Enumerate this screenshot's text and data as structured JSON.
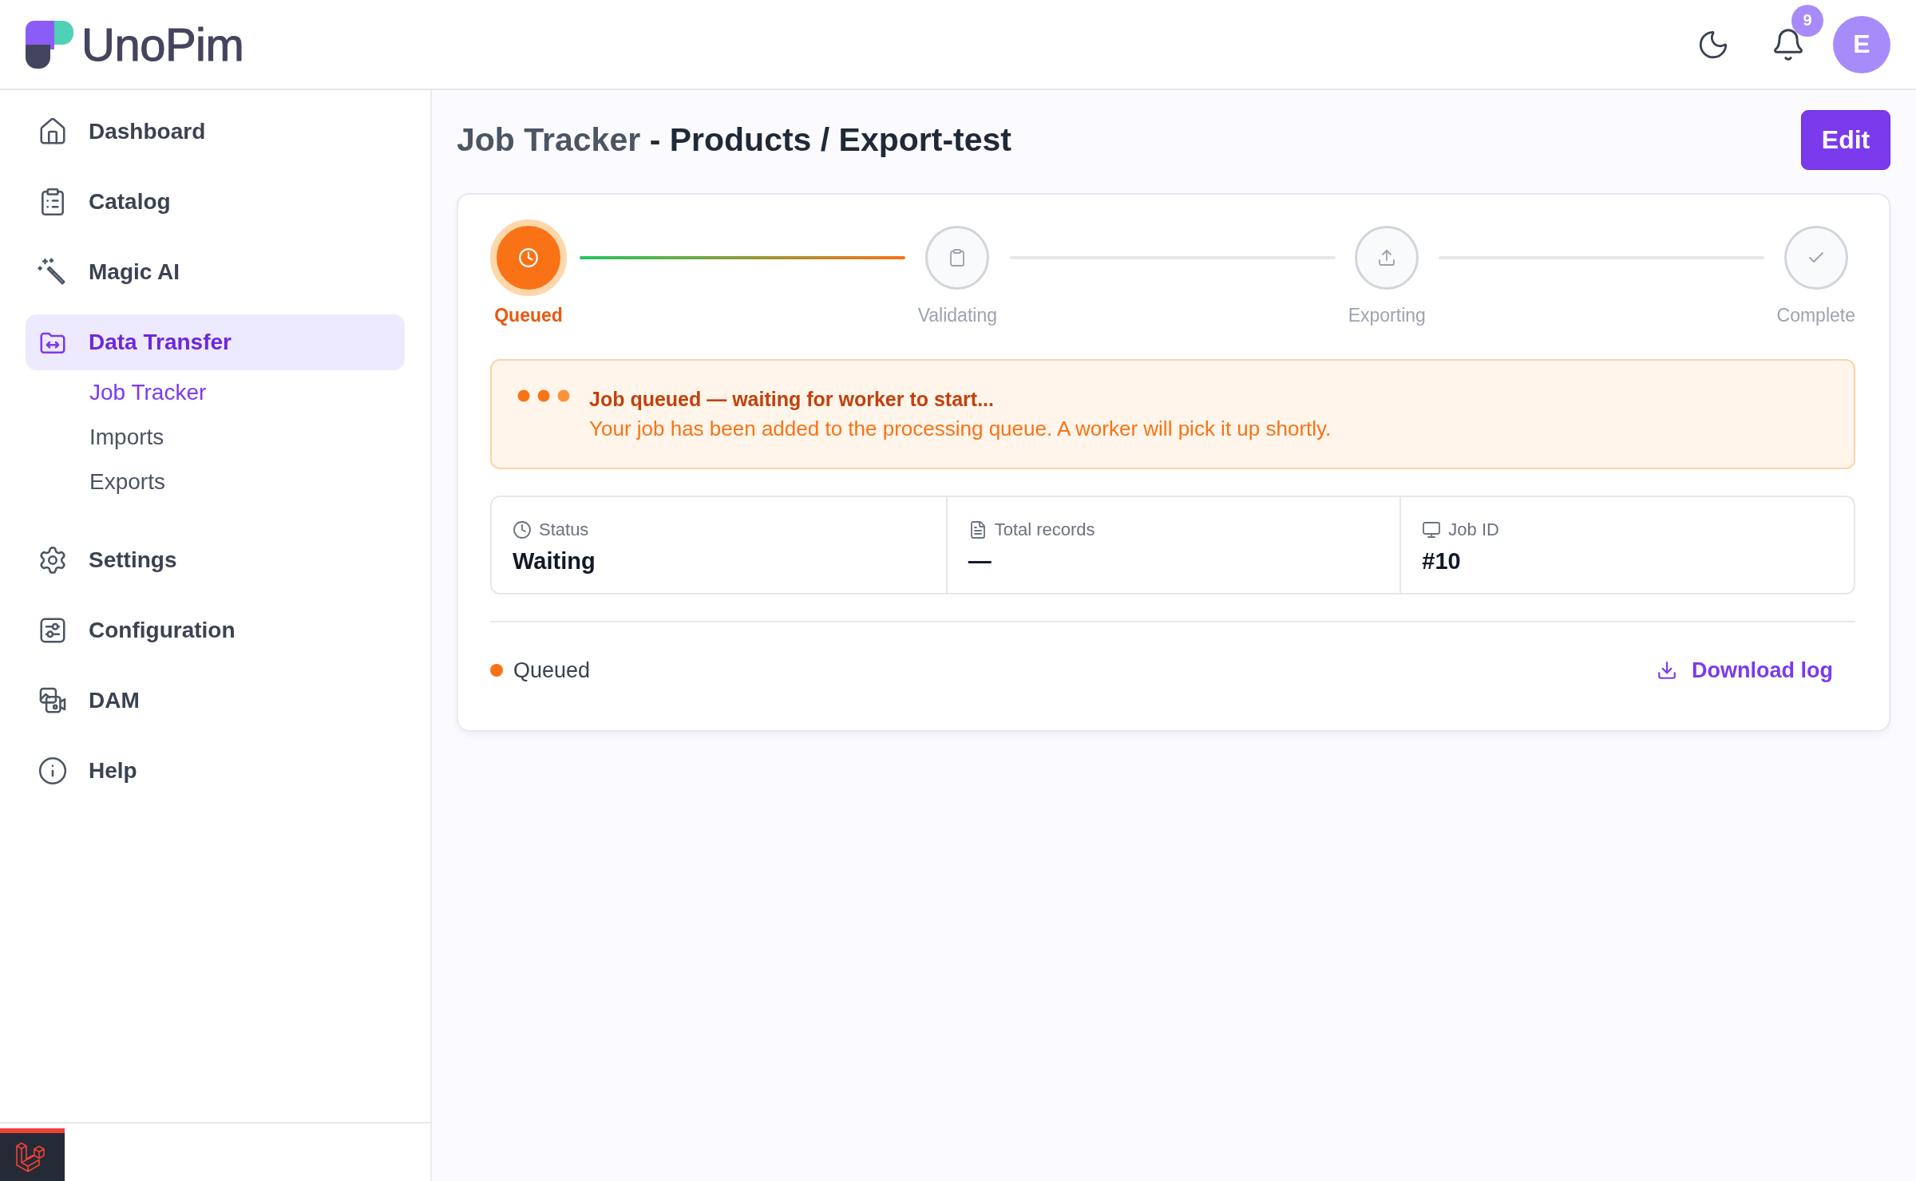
{
  "header": {
    "logo": "UnoPim",
    "notifications": "9",
    "avatar": "E"
  },
  "sidebar": {
    "items": [
      {
        "label": "Dashboard",
        "selected": false
      },
      {
        "label": "Catalog",
        "selected": false
      },
      {
        "label": "Magic AI",
        "selected": false
      },
      {
        "label": "Data Transfer",
        "selected": true,
        "children": [
          {
            "label": "Job Tracker",
            "selected": true
          },
          {
            "label": "Imports",
            "selected": false
          },
          {
            "label": "Exports",
            "selected": false
          }
        ]
      },
      {
        "label": "Settings",
        "selected": false
      },
      {
        "label": "Configuration",
        "selected": false
      },
      {
        "label": "DAM",
        "selected": false
      },
      {
        "label": "Help",
        "selected": false
      }
    ]
  },
  "page": {
    "breadcrumb": "Job Tracker",
    "title": "- Products / Export-test",
    "edit_button": "Edit"
  },
  "stepper": {
    "steps": [
      {
        "label": "Queued",
        "active": true
      },
      {
        "label": "Validating",
        "active": false
      },
      {
        "label": "Exporting",
        "active": false
      },
      {
        "label": "Complete",
        "active": false
      }
    ]
  },
  "alert": {
    "title": "Job queued — waiting for worker to start...",
    "message": "Your job has been added to the processing queue. A worker will pick it up shortly."
  },
  "stats": [
    {
      "label": "Status",
      "value": "Waiting"
    },
    {
      "label": "Total records",
      "value": "—"
    },
    {
      "label": "Job ID",
      "value": "#10"
    }
  ],
  "footer": {
    "status": {
      "label": "Queued",
      "kind": "queued"
    },
    "download_link": "Download log"
  }
}
